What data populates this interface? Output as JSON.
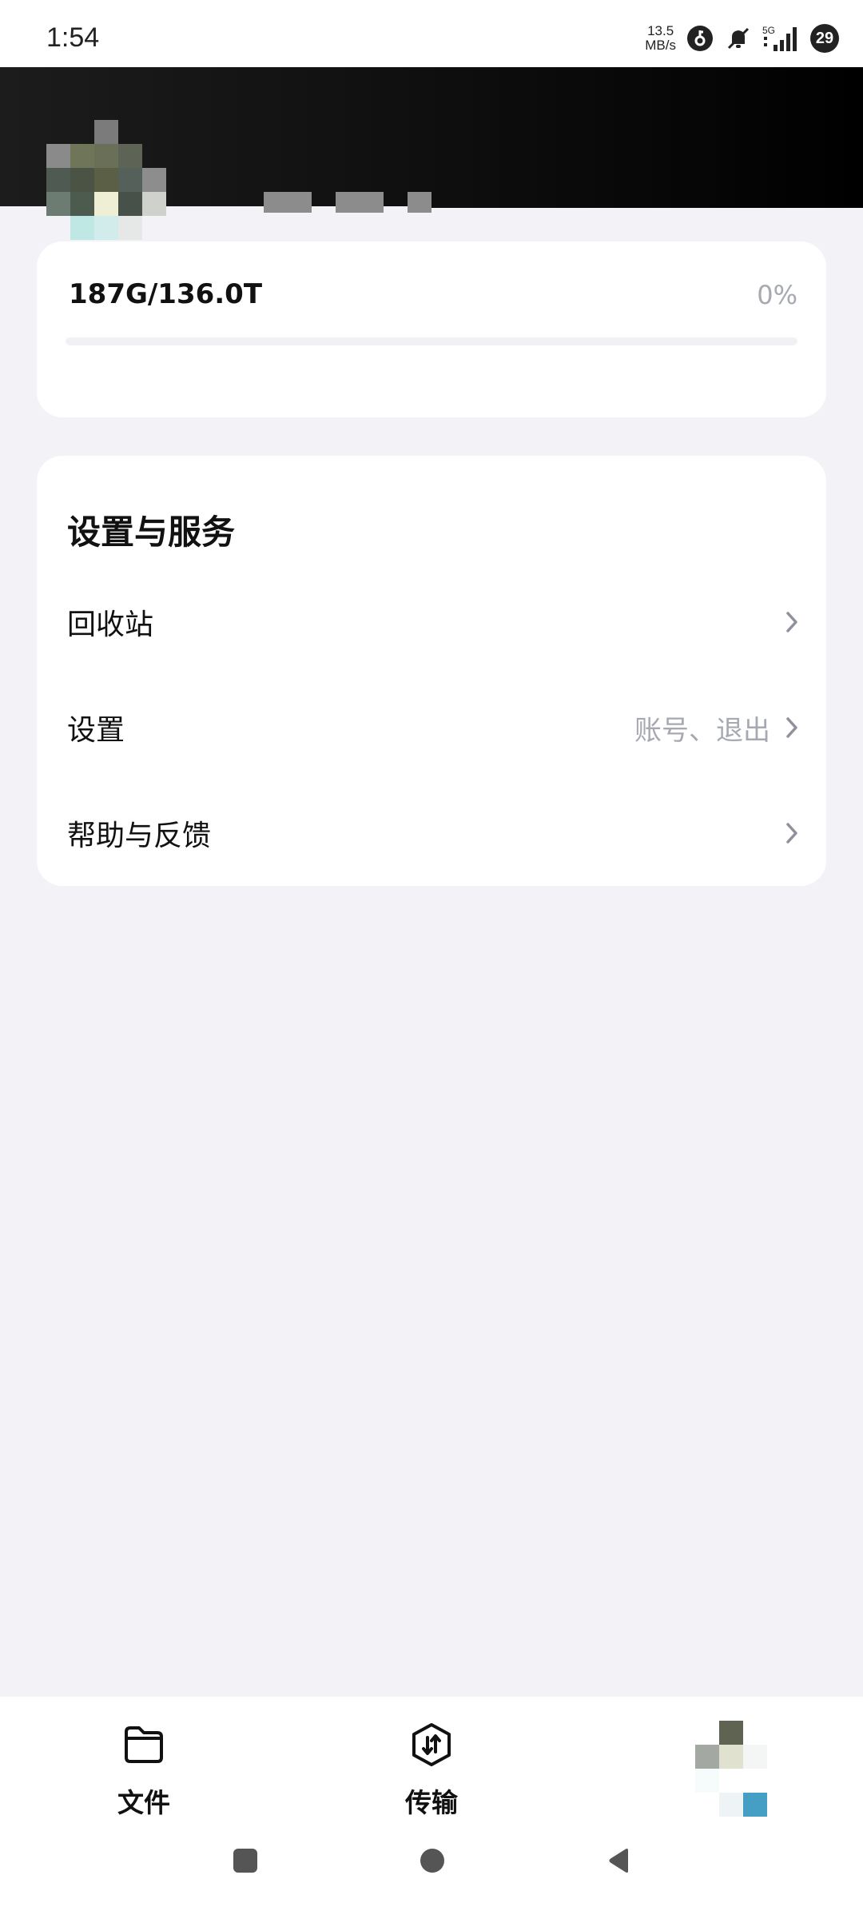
{
  "status_bar": {
    "time": "1:54",
    "net_speed_value": "13.5",
    "net_speed_unit": "MB/s",
    "network": "5G",
    "battery": "29"
  },
  "storage": {
    "usage_text": "187G/136.0T",
    "percent_text": "0%",
    "percent_value": 0
  },
  "settings_section": {
    "title": "设置与服务",
    "items": [
      {
        "label": "回收站",
        "hint": ""
      },
      {
        "label": "设置",
        "hint": "账号、退出"
      },
      {
        "label": "帮助与反馈",
        "hint": ""
      }
    ]
  },
  "bottom_nav": {
    "items": [
      {
        "label": "文件",
        "icon": "folder-icon"
      },
      {
        "label": "传输",
        "icon": "transfer-icon"
      },
      {
        "label": "",
        "icon": "avatar"
      }
    ]
  },
  "colors": {
    "background": "#f3f3f7",
    "card": "#ffffff",
    "header": "#0c0c0c",
    "muted_text": "#a6a9b2",
    "primary_text": "#111111"
  }
}
